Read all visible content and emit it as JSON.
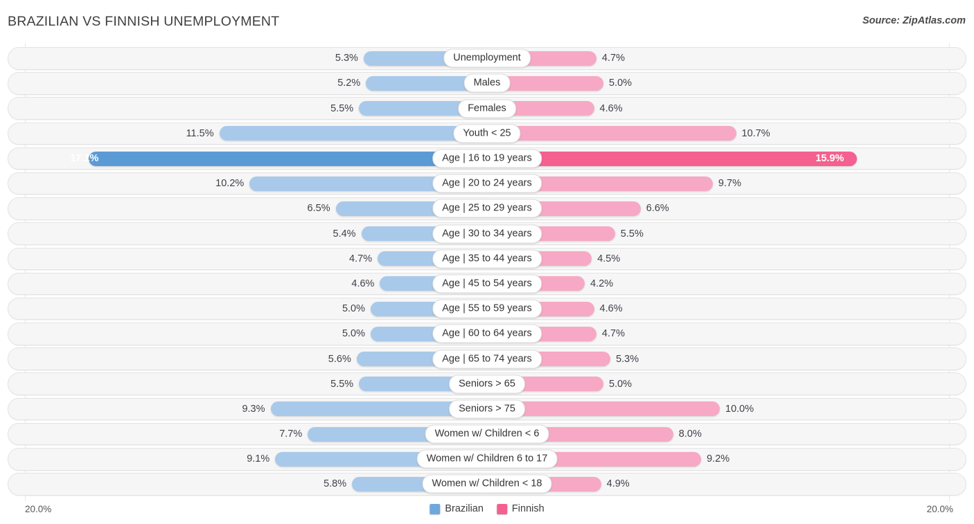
{
  "header": {
    "title": "BRAZILIAN VS FINNISH UNEMPLOYMENT",
    "source": "Source: ZipAtlas.com"
  },
  "footer": {
    "axis_left": "20.0%",
    "axis_right": "20.0%",
    "legend": [
      {
        "label": "Brazilian",
        "color": "#6fa8dc"
      },
      {
        "label": "Finnish",
        "color": "#f4608f"
      }
    ]
  },
  "colors": {
    "brazilian_normal": "#a8c9ea",
    "brazilian_highlight": "#5b9bd5",
    "finnish_normal": "#f7a8c4",
    "finnish_highlight": "#f4608f",
    "track": "#f6f6f6",
    "track_border": "#e3e3e3"
  },
  "chart_data": {
    "type": "bar",
    "title": "BRAZILIAN VS FINNISH UNEMPLOYMENT",
    "subtitle": "",
    "xlabel": "",
    "ylabel": "",
    "orientation": "horizontal-diverging",
    "axis_max": 20.0,
    "xlim": [
      -20.0,
      20.0
    ],
    "grid": false,
    "legend_position": "bottom-center",
    "categories": [
      "Unemployment",
      "Males",
      "Females",
      "Youth < 25",
      "Age | 16 to 19 years",
      "Age | 20 to 24 years",
      "Age | 25 to 29 years",
      "Age | 30 to 34 years",
      "Age | 35 to 44 years",
      "Age | 45 to 54 years",
      "Age | 55 to 59 years",
      "Age | 60 to 64 years",
      "Age | 65 to 74 years",
      "Seniors > 65",
      "Seniors > 75",
      "Women w/ Children < 6",
      "Women w/ Children 6 to 17",
      "Women w/ Children < 18"
    ],
    "series": [
      {
        "name": "Brazilian",
        "side": "left",
        "color": "#a8c9ea",
        "values": [
          5.3,
          5.2,
          5.5,
          11.5,
          17.1,
          10.2,
          6.5,
          5.4,
          4.7,
          4.6,
          5.0,
          5.0,
          5.6,
          5.5,
          9.3,
          7.7,
          9.1,
          5.8
        ],
        "labels": [
          "5.3%",
          "5.2%",
          "5.5%",
          "11.5%",
          "17.1%",
          "10.2%",
          "6.5%",
          "5.4%",
          "4.7%",
          "4.6%",
          "5.0%",
          "5.0%",
          "5.6%",
          "5.5%",
          "9.3%",
          "7.7%",
          "9.1%",
          "5.8%"
        ]
      },
      {
        "name": "Finnish",
        "side": "right",
        "color": "#f7a8c4",
        "values": [
          4.7,
          5.0,
          4.6,
          10.7,
          15.9,
          9.7,
          6.6,
          5.5,
          4.5,
          4.2,
          4.6,
          4.7,
          5.3,
          5.0,
          10.0,
          8.0,
          9.2,
          4.9
        ],
        "labels": [
          "4.7%",
          "5.0%",
          "4.6%",
          "10.7%",
          "15.9%",
          "9.7%",
          "6.6%",
          "5.5%",
          "4.5%",
          "4.2%",
          "4.6%",
          "4.7%",
          "5.3%",
          "5.0%",
          "10.0%",
          "8.0%",
          "9.2%",
          "4.9%"
        ]
      }
    ],
    "highlighted_rows": [
      4
    ]
  }
}
